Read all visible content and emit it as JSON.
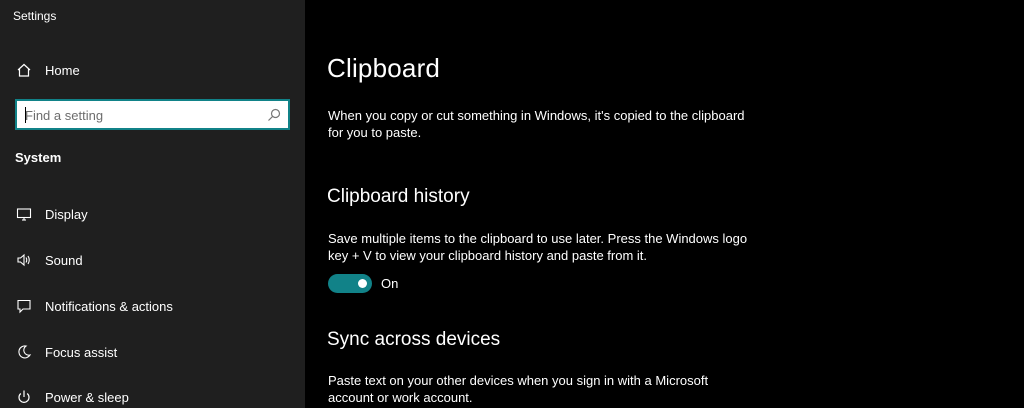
{
  "app": {
    "title": "Settings"
  },
  "sidebar": {
    "home_label": "Home",
    "search_placeholder": "Find a setting",
    "section_label": "System",
    "items": [
      {
        "label": "Display",
        "icon": "display-icon"
      },
      {
        "label": "Sound",
        "icon": "speaker-icon"
      },
      {
        "label": "Notifications & actions",
        "icon": "notification-icon"
      },
      {
        "label": "Focus assist",
        "icon": "moon-icon"
      },
      {
        "label": "Power & sleep",
        "icon": "power-icon"
      }
    ]
  },
  "main": {
    "title": "Clipboard",
    "intro": "When you copy or cut something in Windows, it's copied to the clipboard for you to paste.",
    "history": {
      "heading": "Clipboard history",
      "description": "Save multiple items to the clipboard to use later. Press the Windows logo key + V to view your clipboard history and paste from it.",
      "toggle_state": "On"
    },
    "sync": {
      "heading": "Sync across devices",
      "description": "Paste text on your other devices when you sign in with a Microsoft account or work account."
    }
  },
  "colors": {
    "accent": "#118288",
    "sidebar_bg": "#1f1f1f",
    "content_bg": "#000000"
  }
}
